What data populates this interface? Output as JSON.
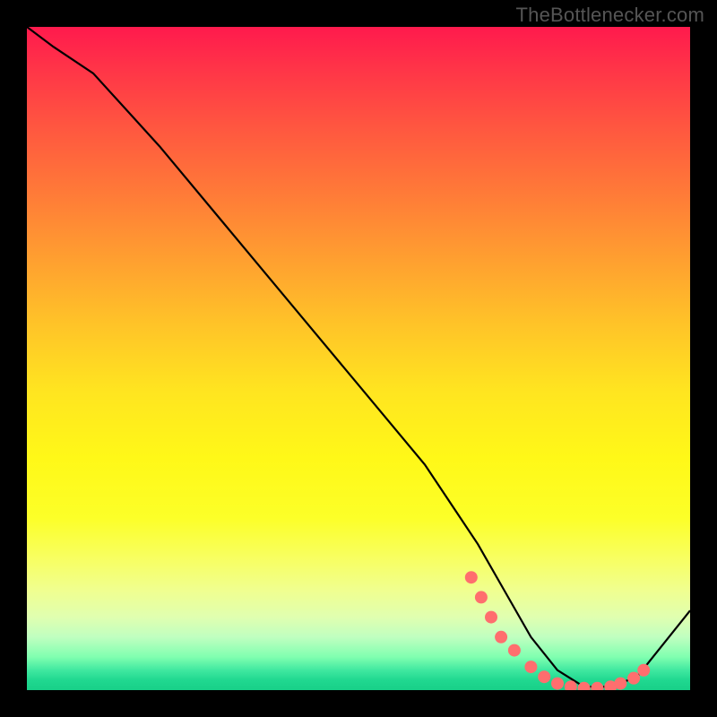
{
  "watermark": "TheBottlenecker.com",
  "chart_data": {
    "type": "line",
    "title": "",
    "xlabel": "",
    "ylabel": "",
    "xlim": [
      0,
      100
    ],
    "ylim": [
      0,
      100
    ],
    "series": [
      {
        "name": "curve",
        "x": [
          0,
          4,
          10,
          20,
          30,
          40,
          50,
          60,
          68,
          72,
          76,
          80,
          84,
          88,
          92,
          100
        ],
        "y": [
          100,
          97,
          93,
          82,
          70,
          58,
          46,
          34,
          22,
          15,
          8,
          3,
          0.5,
          0.5,
          2,
          12
        ]
      }
    ],
    "markers": {
      "name": "highlight-points",
      "color": "#ff6e6e",
      "x": [
        67,
        68.5,
        70,
        71.5,
        73.5,
        76,
        78,
        80,
        82,
        84,
        86,
        88,
        89.5,
        91.5,
        93
      ],
      "y": [
        17,
        14,
        11,
        8,
        6,
        3.5,
        2,
        1,
        0.5,
        0.3,
        0.3,
        0.5,
        1,
        1.8,
        3
      ]
    }
  }
}
